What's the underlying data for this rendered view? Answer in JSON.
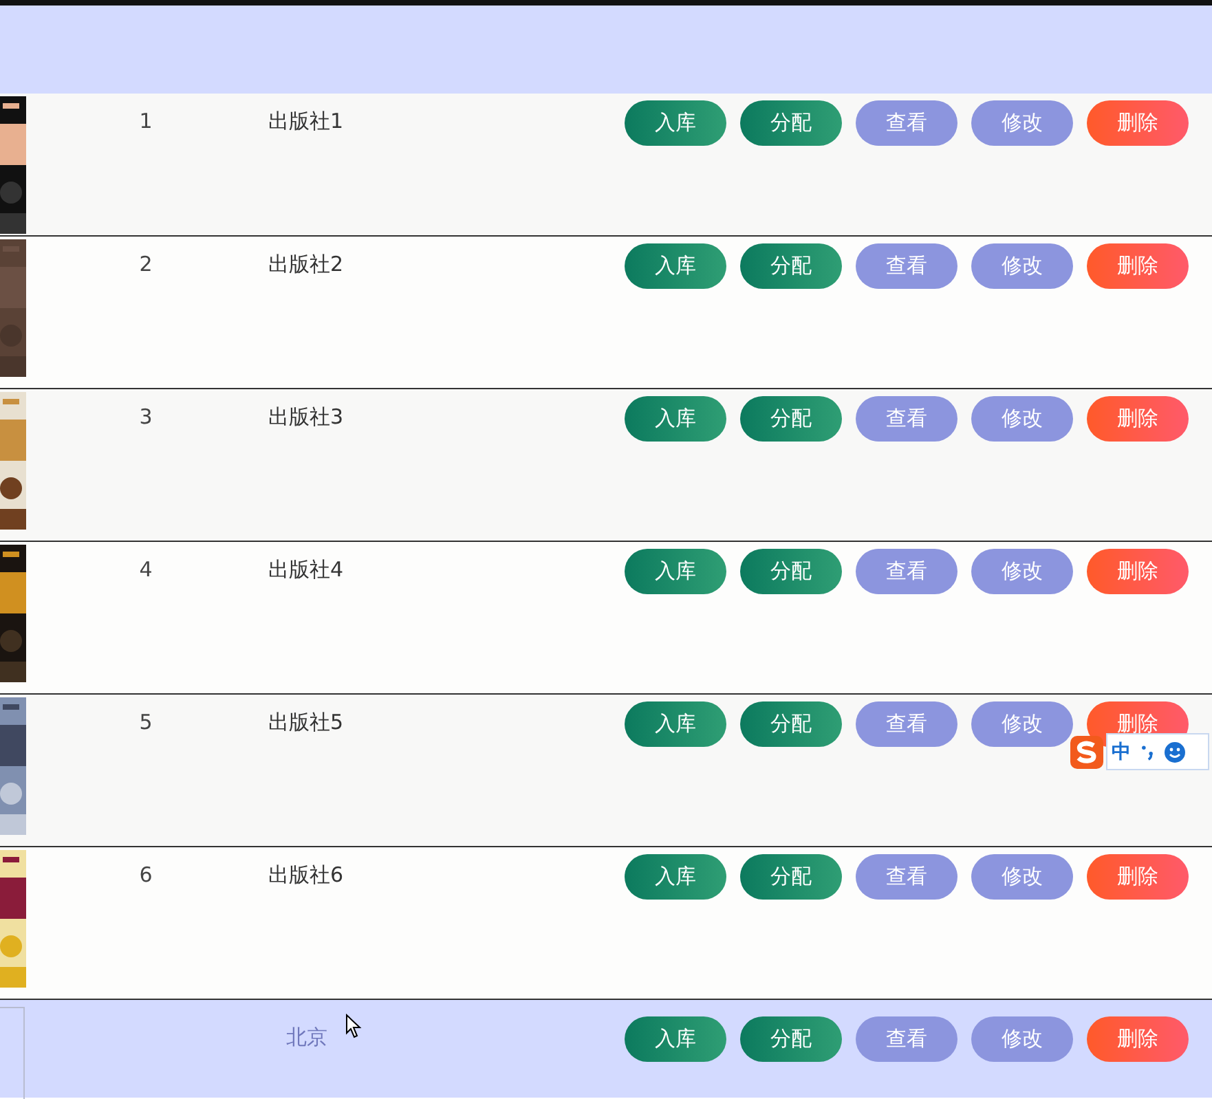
{
  "rows": [
    {
      "number": "1",
      "publisher": "出版社1",
      "has_cover": true,
      "highlighted": false,
      "actions": [
        {
          "label": "入库",
          "kind": "green"
        },
        {
          "label": "分配",
          "kind": "green"
        },
        {
          "label": "查看",
          "kind": "purple"
        },
        {
          "label": "修改",
          "kind": "purple"
        },
        {
          "label": "删除",
          "kind": "red"
        }
      ]
    },
    {
      "number": "2",
      "publisher": "出版社2",
      "has_cover": true,
      "highlighted": false,
      "actions": [
        {
          "label": "入库",
          "kind": "green"
        },
        {
          "label": "分配",
          "kind": "green"
        },
        {
          "label": "查看",
          "kind": "purple"
        },
        {
          "label": "修改",
          "kind": "purple"
        },
        {
          "label": "删除",
          "kind": "red"
        }
      ]
    },
    {
      "number": "3",
      "publisher": "出版社3",
      "has_cover": true,
      "highlighted": false,
      "actions": [
        {
          "label": "入库",
          "kind": "green"
        },
        {
          "label": "分配",
          "kind": "green"
        },
        {
          "label": "查看",
          "kind": "purple"
        },
        {
          "label": "修改",
          "kind": "purple"
        },
        {
          "label": "删除",
          "kind": "red"
        }
      ]
    },
    {
      "number": "4",
      "publisher": "出版社4",
      "has_cover": true,
      "highlighted": false,
      "actions": [
        {
          "label": "入库",
          "kind": "green"
        },
        {
          "label": "分配",
          "kind": "green"
        },
        {
          "label": "查看",
          "kind": "purple"
        },
        {
          "label": "修改",
          "kind": "purple"
        },
        {
          "label": "删除",
          "kind": "red"
        }
      ]
    },
    {
      "number": "5",
      "publisher": "出版社5",
      "has_cover": true,
      "highlighted": false,
      "actions": [
        {
          "label": "入库",
          "kind": "green"
        },
        {
          "label": "分配",
          "kind": "green"
        },
        {
          "label": "查看",
          "kind": "purple"
        },
        {
          "label": "修改",
          "kind": "purple"
        },
        {
          "label": "删除",
          "kind": "red"
        }
      ]
    },
    {
      "number": "6",
      "publisher": "出版社6",
      "has_cover": true,
      "highlighted": false,
      "actions": [
        {
          "label": "入库",
          "kind": "green"
        },
        {
          "label": "分配",
          "kind": "green"
        },
        {
          "label": "查看",
          "kind": "purple"
        },
        {
          "label": "修改",
          "kind": "purple"
        },
        {
          "label": "删除",
          "kind": "red"
        }
      ]
    },
    {
      "publisher": "北京",
      "has_cover": false,
      "highlighted": true,
      "actions": [
        {
          "label": "入库",
          "kind": "green"
        },
        {
          "label": "分配",
          "kind": "green"
        },
        {
          "label": "查看",
          "kind": "purple"
        },
        {
          "label": "修改",
          "kind": "purple"
        },
        {
          "label": "删除",
          "kind": "red"
        }
      ]
    }
  ],
  "ime_bar": {
    "mode": "中"
  }
}
